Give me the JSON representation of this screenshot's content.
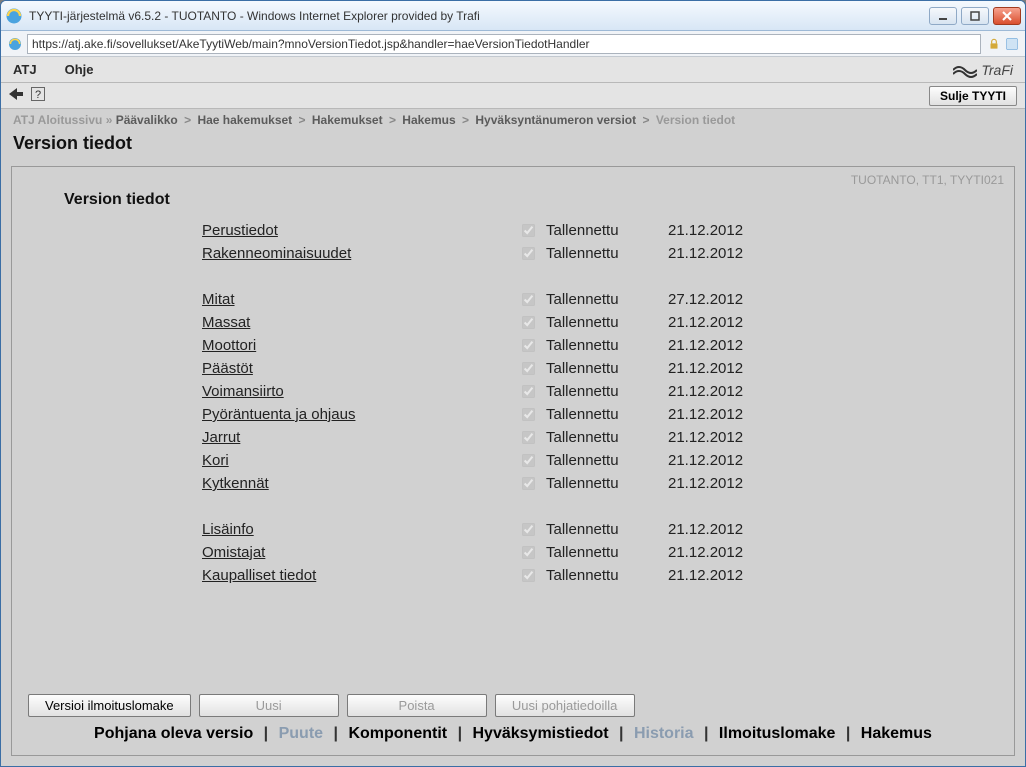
{
  "window": {
    "title": "TYYTI-järjestelmä v6.5.2 - TUOTANTO - Windows Internet Explorer provided by Trafi",
    "url": "https://atj.ake.fi/sovellukset/AkeTyytiWeb/main?mnoVersionTiedot.jsp&handler=haeVersionTiedotHandler"
  },
  "menubar": {
    "atj": "ATJ",
    "ohje": "Ohje",
    "brand": "TraFi"
  },
  "toolbar": {
    "close_label": "Sulje TYYTI"
  },
  "breadcrumb": {
    "root": "ATJ Aloitussivu",
    "items": [
      "Päävalikko",
      "Hae hakemukset",
      "Hakemukset",
      "Hakemus",
      "Hyväksyntänumeron versiot"
    ],
    "current": "Version tiedot"
  },
  "page_title": "Version tiedot",
  "status_top": "TUOTANTO, TT1, TYYTI021",
  "section_title": "Version tiedot",
  "groups": [
    [
      {
        "label": "Perustiedot",
        "status": "Tallennettu",
        "date": "21.12.2012"
      },
      {
        "label": "Rakenneominaisuudet",
        "status": "Tallennettu",
        "date": "21.12.2012"
      }
    ],
    [
      {
        "label": "Mitat",
        "status": "Tallennettu",
        "date": "27.12.2012"
      },
      {
        "label": "Massat",
        "status": "Tallennettu",
        "date": "21.12.2012"
      },
      {
        "label": "Moottori",
        "status": "Tallennettu",
        "date": "21.12.2012"
      },
      {
        "label": "Päästöt",
        "status": "Tallennettu",
        "date": "21.12.2012"
      },
      {
        "label": "Voimansiirto",
        "status": "Tallennettu",
        "date": "21.12.2012"
      },
      {
        "label": "Pyöräntuenta ja ohjaus",
        "status": "Tallennettu",
        "date": "21.12.2012"
      },
      {
        "label": "Jarrut",
        "status": "Tallennettu",
        "date": "21.12.2012"
      },
      {
        "label": "Kori",
        "status": "Tallennettu",
        "date": "21.12.2012"
      },
      {
        "label": "Kytkennät",
        "status": "Tallennettu",
        "date": "21.12.2012"
      }
    ],
    [
      {
        "label": "Lisäinfo",
        "status": "Tallennettu",
        "date": "21.12.2012"
      },
      {
        "label": "Omistajat",
        "status": "Tallennettu",
        "date": "21.12.2012"
      },
      {
        "label": "Kaupalliset tiedot",
        "status": "Tallennettu",
        "date": "21.12.2012"
      }
    ]
  ],
  "buttons": {
    "versioi": "Versioi ilmoituslomake",
    "uusi": "Uusi",
    "poista": "Poista",
    "pohja": "Uusi pohjatiedoilla"
  },
  "tabs": {
    "pohjana": "Pohjana oleva versio",
    "puute": "Puute",
    "komponentit": "Komponentit",
    "hyvaksymis": "Hyväksymistiedot",
    "historia": "Historia",
    "ilmoitus": "Ilmoituslomake",
    "hakemus": "Hakemus"
  }
}
